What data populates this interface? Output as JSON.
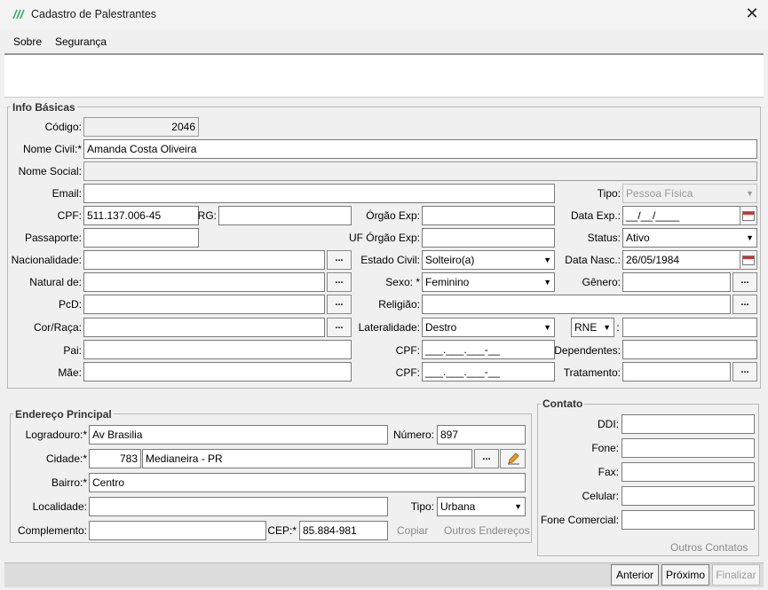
{
  "window": {
    "title": "Cadastro de Palestrantes",
    "close_glyph": "✕"
  },
  "menu": {
    "sobre": "Sobre",
    "seguranca": "Segurança"
  },
  "info": {
    "legend": "Info Básicas",
    "codigo": {
      "label": "Código:",
      "value": "2046"
    },
    "nome_civil": {
      "label": "Nome Civil:*",
      "value": "Amanda Costa Oliveira"
    },
    "nome_social": {
      "label": "Nome Social:",
      "value": ""
    },
    "email": {
      "label": "Email:",
      "value": ""
    },
    "tipo": {
      "label": "Tipo:",
      "value": "Pessoa Física"
    },
    "cpf": {
      "label": "CPF:",
      "value": "511.137.006-45"
    },
    "rg": {
      "label": "RG:",
      "value": ""
    },
    "orgao_exp": {
      "label": "Órgão Exp:",
      "value": ""
    },
    "data_exp": {
      "label": "Data Exp.:",
      "value": "__/__/____"
    },
    "passaporte": {
      "label": "Passaporte:",
      "value": ""
    },
    "uf_orgao_exp": {
      "label": "UF Órgão Exp:",
      "value": ""
    },
    "status": {
      "label": "Status:",
      "value": "Ativo"
    },
    "nacionalidade": {
      "label": "Nacionalidade:",
      "value": ""
    },
    "estado_civil": {
      "label": "Estado Civil:",
      "value": "Solteiro(a)"
    },
    "data_nasc": {
      "label": "Data Nasc.:",
      "value": "26/05/1984"
    },
    "natural_de": {
      "label": "Natural de:",
      "value": ""
    },
    "sexo": {
      "label": "Sexo: *",
      "value": "Feminino"
    },
    "genero": {
      "label": "Gênero:",
      "value": ""
    },
    "pcd": {
      "label": "PcD:",
      "value": ""
    },
    "religiao": {
      "label": "Religião:",
      "value": ""
    },
    "cor_raca": {
      "label": "Cor/Raça:",
      "value": ""
    },
    "lateralidade": {
      "label": "Lateralidade:",
      "value": "Destro"
    },
    "rne": {
      "value": "RNE",
      "suffix": ":",
      "field": ""
    },
    "pai": {
      "label": "Pai:",
      "value": ""
    },
    "cpf_pai": {
      "label": "CPF:",
      "value": "___.___.___-__"
    },
    "dependentes": {
      "label": "Dependentes:",
      "value": ""
    },
    "mae": {
      "label": "Mãe:",
      "value": ""
    },
    "cpf_mae": {
      "label": "CPF:",
      "value": "___.___.___-__"
    },
    "tratamento": {
      "label": "Tratamento:",
      "value": ""
    },
    "dots": "..."
  },
  "endereco": {
    "legend": "Endereço Principal",
    "logradouro": {
      "label": "Logradouro:*",
      "value": "Av Brasilia"
    },
    "numero": {
      "label": "Número:",
      "value": "897"
    },
    "cidade": {
      "label": "Cidade:*",
      "code": "783",
      "value": "Medianeira - PR"
    },
    "bairro": {
      "label": "Bairro:*",
      "value": "Centro"
    },
    "localidade": {
      "label": "Localidade:",
      "value": ""
    },
    "tipo": {
      "label": "Tipo:",
      "value": "Urbana"
    },
    "complemento": {
      "label": "Complemento:",
      "value": ""
    },
    "cep": {
      "label": "CEP:*",
      "value": "85.884-981"
    },
    "copiar": "Copiar",
    "outros": "Outros Endereços"
  },
  "contato": {
    "legend": "Contato",
    "ddi": {
      "label": "DDI:",
      "value": ""
    },
    "fone": {
      "label": "Fone:",
      "value": ""
    },
    "fax": {
      "label": "Fax:",
      "value": ""
    },
    "celular": {
      "label": "Celular:",
      "value": ""
    },
    "fone_comercial": {
      "label": "Fone Comercial:",
      "value": ""
    },
    "outros": "Outros Contatos"
  },
  "nav": {
    "anterior": "Anterior",
    "proximo": "Próximo",
    "finalizar": "Finalizar"
  }
}
